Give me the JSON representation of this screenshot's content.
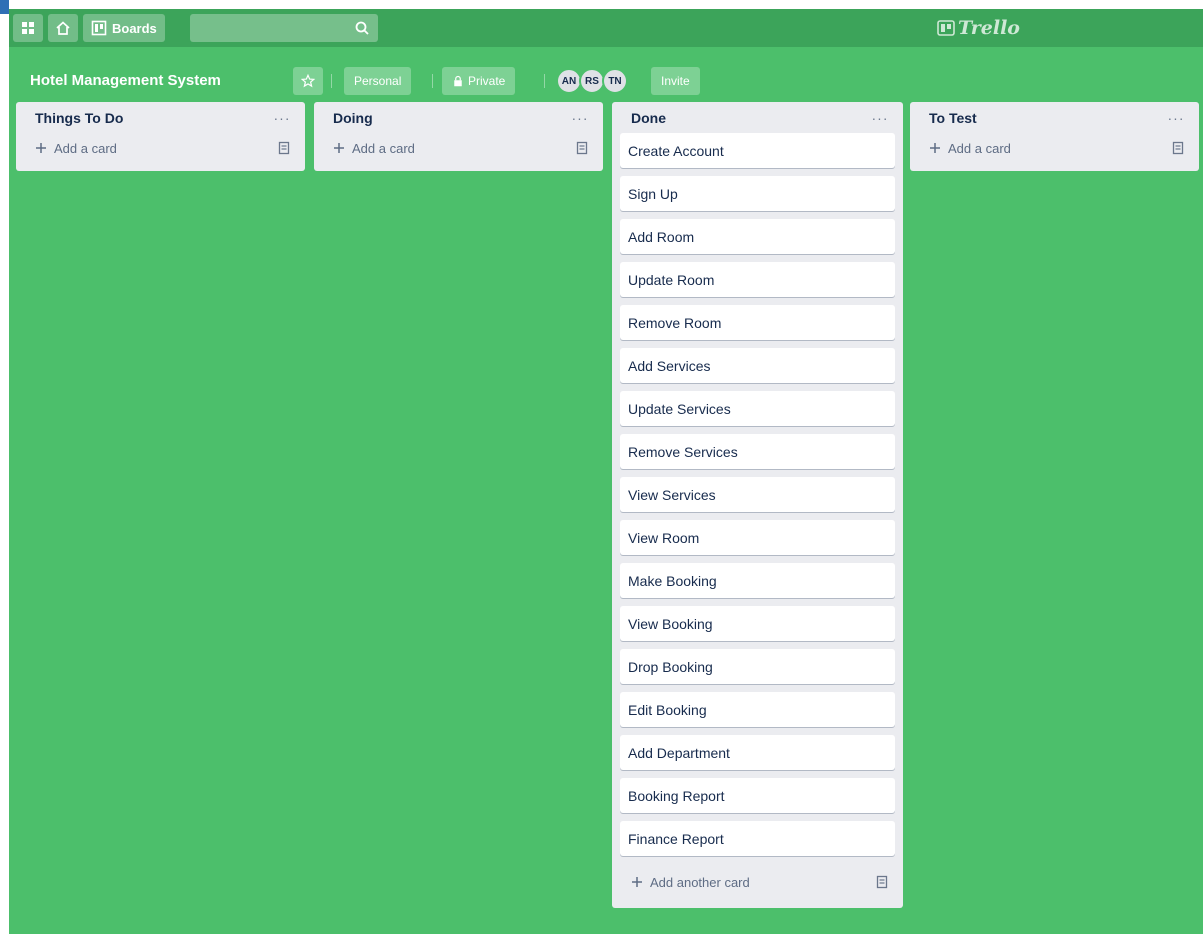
{
  "header": {
    "boards_label": "Boards",
    "search_value": "",
    "logo_text": "Trello"
  },
  "board": {
    "title": "Hotel Management System",
    "team_label": "Personal",
    "visibility_label": "Private",
    "members": [
      "AN",
      "RS",
      "TN"
    ],
    "invite_label": "Invite"
  },
  "lists": [
    {
      "title": "Things To Do",
      "cards": [],
      "add_label": "Add a card"
    },
    {
      "title": "Doing",
      "cards": [],
      "add_label": "Add a card"
    },
    {
      "title": "Done",
      "cards": [
        "Create Account",
        "Sign Up",
        "Add Room",
        "Update Room",
        "Remove Room",
        "Add Services",
        "Update Services",
        "Remove Services",
        "View Services",
        "View Room",
        "Make Booking",
        "View Booking",
        "Drop Booking",
        "Edit Booking",
        "Add Department",
        "Booking Report",
        "Finance Report"
      ],
      "add_label": "Add another card"
    },
    {
      "title": "To Test",
      "cards": [],
      "add_label": "Add a card"
    }
  ],
  "colors": {
    "board_bg": "#4cbf6b",
    "appbar_bg": "#3ca45a",
    "list_bg": "#ebecf0"
  },
  "icons": {
    "apps": "grid-icon",
    "home": "home-icon",
    "boards": "boards-icon",
    "search": "search-icon",
    "star": "star-icon",
    "lock": "lock-icon",
    "add": "plus-icon",
    "template": "template-icon",
    "list_menu": "more-horizontal-icon"
  }
}
